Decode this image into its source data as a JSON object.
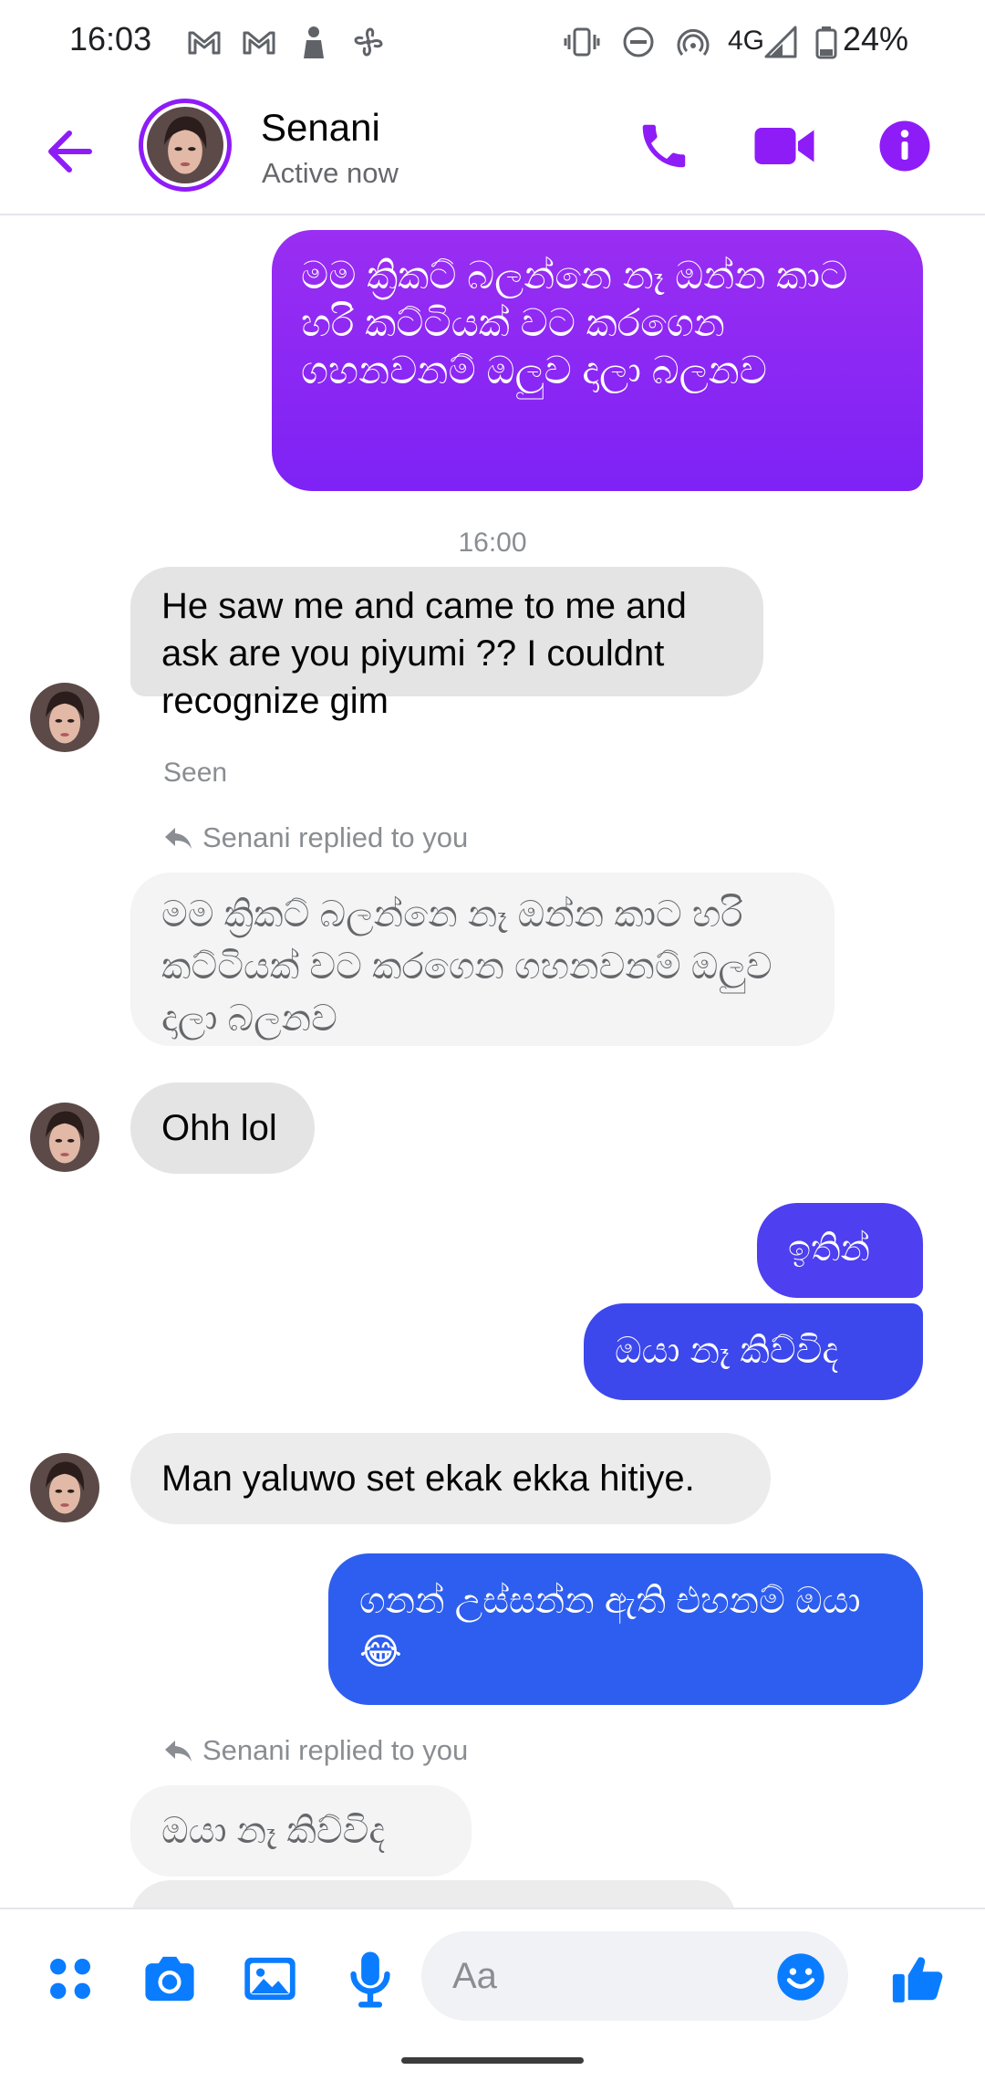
{
  "status_bar": {
    "time": "16:03",
    "network": "4G",
    "battery": "24%",
    "left_icons": [
      "gmail-icon",
      "gmail-icon",
      "person-lock-icon",
      "fan-icon"
    ],
    "right_icons": [
      "vibrate-icon",
      "dnd-icon",
      "hotspot-icon",
      "signal-icon",
      "battery-icon"
    ]
  },
  "header": {
    "name": "Senani",
    "status": "Active now",
    "accent_color": "#8e1cf7"
  },
  "messages": {
    "m1": "මම ක්‍රිකට් බලන්නෙ නෑ ඔන්න කාට හරි කට්ටියක් වට කරගෙන ගහනවනම් ඔලුව දාලා බලනව",
    "timestamp": "16:00",
    "m2": "He saw me and came to me and ask are you piyumi ?? I couldnt recognize gim",
    "seen": "Seen",
    "replied_1": "Senani replied to you",
    "quote_1": "මම ක්‍රිකට් බලන්නෙ නෑ  ඔන්න කාට හරි කට්ටියක් වට කරගෙන ගහනවනම් ඔලුව දාලා බලනව",
    "m3": "Ohh lol",
    "m4": "ඉතින්",
    "m5": "ඔයා නෑ කිව්විද",
    "m6": "Man yaluwo set ekak ekka hitiye.",
    "m7": "ගනන් උස්සන්න ඇති එහනම් ඔයා 😂",
    "replied_2": "Senani replied to you",
    "quote_2": "ඔයා නෑ කිව්විද"
  },
  "composer": {
    "placeholder": "Aa",
    "icons": [
      "apps-icon",
      "camera-icon",
      "gallery-icon",
      "mic-icon",
      "emoji-icon",
      "like-icon"
    ],
    "accent_color": "#0a7cff"
  }
}
